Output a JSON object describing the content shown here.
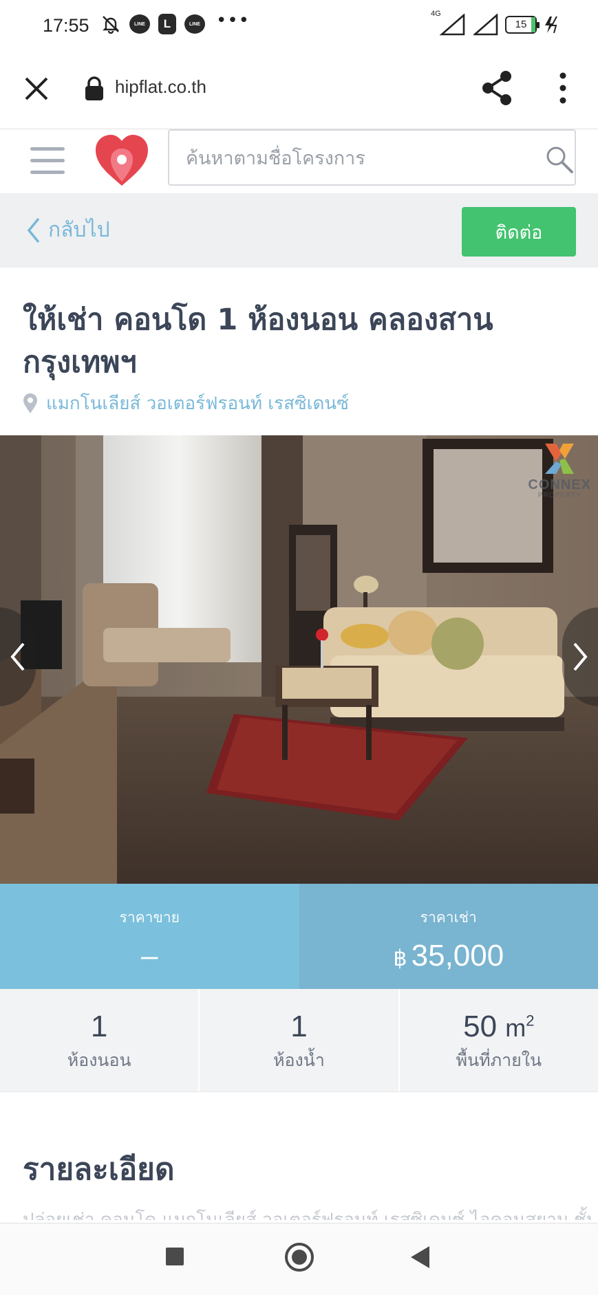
{
  "status_bar": {
    "time": "17:55",
    "line_badge_text": "LINE",
    "l_badge_text": "L",
    "more_dots": "•••",
    "network": "4G",
    "battery": "15"
  },
  "browser": {
    "url": "hipflat.co.th",
    "icons": [
      "close-icon",
      "lock-icon",
      "share-icon",
      "more-vertical-icon"
    ]
  },
  "header": {
    "search_placeholder": "ค้นหาตามชื่อโครงการ",
    "icons": [
      "menu-icon",
      "hipflat-logo",
      "search-icon"
    ],
    "brand_color": "#e5454f"
  },
  "back_bar": {
    "back_label": "กลับไป",
    "contact_label": "ติดต่อ",
    "contact_color": "#43c36f",
    "link_color": "#79b8d8"
  },
  "listing": {
    "title_line1": "ให้เช่า คอนโด 1 ห้องนอน คลองสาน",
    "title_line2": "กรุงเทพฯ",
    "location": "แมกโนเลียส์ วอเตอร์ฟรอนท์ เรสซิเดนซ์",
    "photo_watermark": "CONNEX",
    "photo_watermark_sub": "PROPERTY"
  },
  "prices": {
    "sale_label": "ราคาขาย",
    "sale_value": "–",
    "rent_label": "ราคาเช่า",
    "rent_currency": "฿",
    "rent_value": "35,000"
  },
  "stats": [
    {
      "value": "1",
      "unit": "",
      "sup": "",
      "label": "ห้องนอน"
    },
    {
      "value": "1",
      "unit": "",
      "sup": "",
      "label": "ห้องน้ำ"
    },
    {
      "value": "50",
      "unit": "m",
      "sup": "2",
      "label": "พื้นที่ภายใน"
    }
  ],
  "details": {
    "heading": "รายละเอียด",
    "preview": "ปล่อยเช่า คอนโด แมกโนเลียส์ วอเตอร์ฟรอนท์ เรสซิเดนซ์ ไอคอนสยาม ชั้น"
  },
  "android_nav": {
    "icons": [
      "recent-apps-icon",
      "home-icon",
      "back-icon"
    ]
  }
}
